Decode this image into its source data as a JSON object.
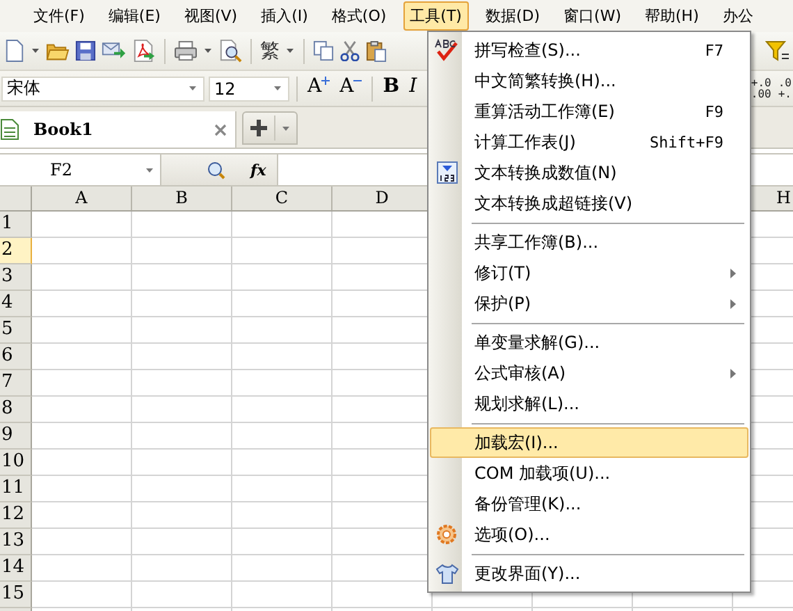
{
  "menubar": [
    {
      "label": "文件(F)",
      "selected": false
    },
    {
      "label": "编辑(E)",
      "selected": false
    },
    {
      "label": "视图(V)",
      "selected": false
    },
    {
      "label": "插入(I)",
      "selected": false
    },
    {
      "label": "格式(O)",
      "selected": false
    },
    {
      "label": "工具(T)",
      "selected": true
    },
    {
      "label": "数据(D)",
      "selected": false
    },
    {
      "label": "窗口(W)",
      "selected": false
    },
    {
      "label": "帮助(H)",
      "selected": false
    },
    {
      "label": "办公",
      "selected": false
    }
  ],
  "toolbar": {
    "convert_label": "繁"
  },
  "format_bar": {
    "font_name": "宋体",
    "font_size": "12",
    "buttons": [
      {
        "kind": "grow",
        "label": "A"
      },
      {
        "kind": "shrink",
        "label": "A"
      },
      {
        "kind": "bold",
        "label": "B"
      },
      {
        "kind": "italic",
        "label": "I"
      }
    ],
    "decimal_buttons": [
      {
        "top": "+.0",
        "bottom": ".00"
      },
      {
        "top": ".0",
        "bottom": "+."
      }
    ]
  },
  "tabs": [
    {
      "label": "Book1",
      "selected": true
    }
  ],
  "formula_bar": {
    "name_box": "F2",
    "function_label": "fx"
  },
  "sheet": {
    "columns_left": [
      "A",
      "B",
      "C",
      "D"
    ],
    "columns_right": [
      "H"
    ],
    "rows": [
      {
        "label": "1",
        "selected": false
      },
      {
        "label": "2",
        "selected": true
      },
      {
        "label": "3",
        "selected": false
      },
      {
        "label": "4",
        "selected": false
      },
      {
        "label": "5",
        "selected": false
      },
      {
        "label": "6",
        "selected": false
      },
      {
        "label": "7",
        "selected": false
      },
      {
        "label": "8",
        "selected": false
      },
      {
        "label": "9",
        "selected": false
      },
      {
        "label": "10",
        "selected": false
      },
      {
        "label": "11",
        "selected": false
      },
      {
        "label": "12",
        "selected": false
      },
      {
        "label": "13",
        "selected": false
      },
      {
        "label": "14",
        "selected": false
      },
      {
        "label": "15",
        "selected": false
      }
    ]
  },
  "tools_menu": [
    {
      "kind": "item",
      "label": "拼写检查(S)...",
      "shortcut": "F7",
      "submenu": false,
      "selected": false
    },
    {
      "kind": "item",
      "label": "中文简繁转换(H)...",
      "submenu": false,
      "selected": false
    },
    {
      "kind": "item",
      "label": "重算活动工作簿(E)",
      "shortcut": "F9",
      "submenu": false,
      "selected": false
    },
    {
      "kind": "item",
      "label": "计算工作表(J)",
      "shortcut": "Shift+F9",
      "submenu": false,
      "selected": false
    },
    {
      "kind": "item",
      "label": "文本转换成数值(N)",
      "submenu": false,
      "selected": false
    },
    {
      "kind": "item",
      "label": "文本转换成超链接(V)",
      "submenu": false,
      "selected": false
    },
    {
      "kind": "separator"
    },
    {
      "kind": "item",
      "label": "共享工作簿(B)...",
      "submenu": false,
      "selected": false
    },
    {
      "kind": "item",
      "label": "修订(T)",
      "submenu": true,
      "selected": false
    },
    {
      "kind": "item",
      "label": "保护(P)",
      "submenu": true,
      "selected": false
    },
    {
      "kind": "separator"
    },
    {
      "kind": "item",
      "label": "单变量求解(G)...",
      "submenu": false,
      "selected": false
    },
    {
      "kind": "item",
      "label": "公式审核(A)",
      "submenu": true,
      "selected": false
    },
    {
      "kind": "item",
      "label": "规划求解(L)...",
      "submenu": false,
      "selected": false
    },
    {
      "kind": "separator"
    },
    {
      "kind": "item",
      "label": "加载宏(I)...",
      "submenu": false,
      "selected": true
    },
    {
      "kind": "item",
      "label": "COM 加载项(U)...",
      "submenu": false,
      "selected": false
    },
    {
      "kind": "item",
      "label": "备份管理(K)...",
      "submenu": false,
      "selected": false
    },
    {
      "kind": "item",
      "label": "选项(O)...",
      "submenu": false,
      "selected": false
    },
    {
      "kind": "separator"
    },
    {
      "kind": "item",
      "label": "更改界面(Y)...",
      "submenu": false,
      "selected": false
    }
  ]
}
